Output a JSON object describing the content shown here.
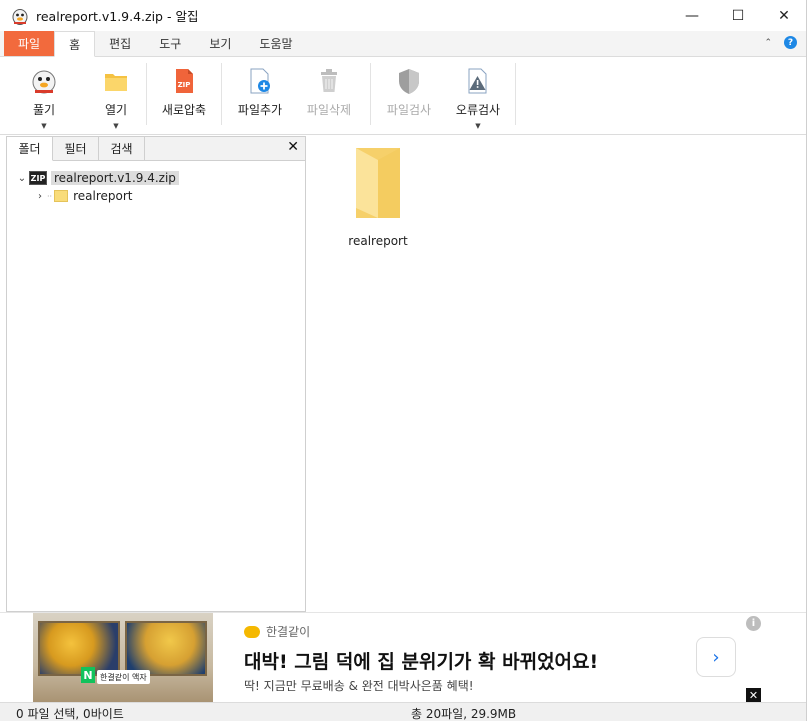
{
  "window": {
    "title": "realreport.v1.9.4.zip - 알집",
    "minimize": "—",
    "maximize": "☐",
    "close": "✕"
  },
  "ribbon_tabs": [
    "파일",
    "홈",
    "편집",
    "도구",
    "보기",
    "도움말"
  ],
  "active_tab": "홈",
  "toolbar": {
    "unzip": "풀기",
    "open": "열기",
    "new_archive": "새로압축",
    "add_file": "파일추가",
    "delete_file": "파일삭제",
    "scan_file": "파일검사",
    "error_check": "오류검사"
  },
  "panel": {
    "tabs": [
      "폴더",
      "필터",
      "검색"
    ],
    "close": "✕"
  },
  "tree": {
    "root": "realreport.v1.9.4.zip",
    "root_icon_text": "ZIP",
    "child": "realreport"
  },
  "files": [
    {
      "name": "realreport",
      "icon": "folder-icon"
    }
  ],
  "ad": {
    "brand": "한결같이",
    "headline": "대박! 그림 덕에 집 분위기가 확 바뀌었어요!",
    "subtext": "딱! 지금만 무료배송 & 완전 대박사은품 혜택!",
    "image_badge": "한결같이 액자",
    "image_logo": "N",
    "arrow": "›",
    "info": "i",
    "close": "✕"
  },
  "status": {
    "selection": "0 파일 선택,  0바이트",
    "total": "총 20파일,  29.9MB"
  },
  "colors": {
    "file_tab": "#f26a3d",
    "folder": "#f9dc7a",
    "help": "#1e88e5"
  }
}
